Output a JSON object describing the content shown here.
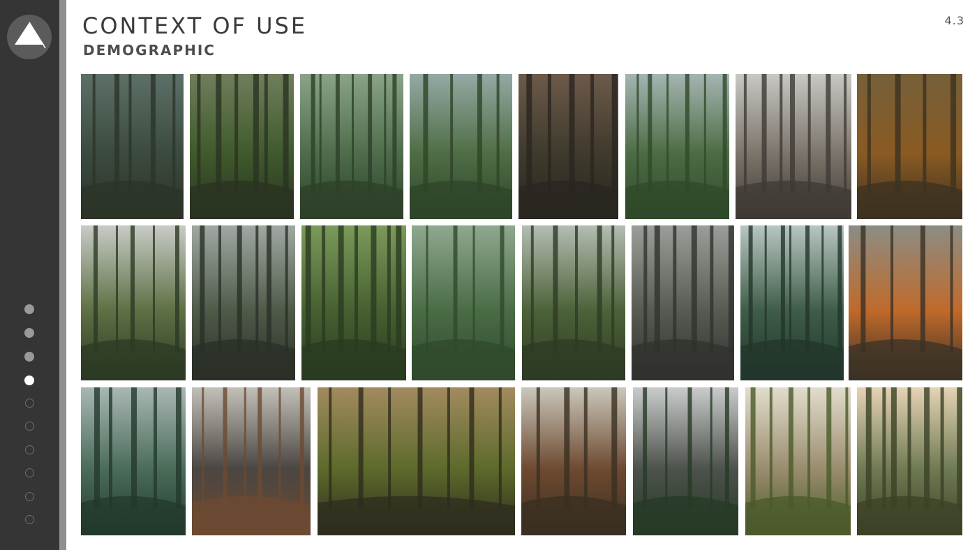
{
  "slide": {
    "title": "CONTEXT OF USE",
    "subtitle": "DEMOGRAPHIC",
    "page_number": "4.3"
  },
  "logo": {
    "icon": "mountain-triangle-icon"
  },
  "progress": {
    "total_steps": 10,
    "current_step": 4
  },
  "colors": {
    "sidebar": "#353535",
    "sidebar_edge": "#8f8f8f",
    "title_text": "#3a3a3a"
  },
  "gallery": {
    "rows": [
      {
        "photos": [
          {
            "scene": "misty-forest-path",
            "palette": [
              "#5d7067",
              "#3b4a3f",
              "#2c3428"
            ]
          },
          {
            "scene": "mossy-trail",
            "palette": [
              "#6f7e5c",
              "#3f5a2c",
              "#2a3322"
            ]
          },
          {
            "scene": "green-forest-path",
            "palette": [
              "#8aa389",
              "#4e6c4b",
              "#2d4029"
            ]
          },
          {
            "scene": "hikers-mountain-lake",
            "palette": [
              "#94a9a4",
              "#4e6d45",
              "#2f4428"
            ]
          },
          {
            "scene": "dark-pine-forest",
            "palette": [
              "#6d5a4a",
              "#3e3a2c",
              "#2a2620"
            ]
          },
          {
            "scene": "alpine-stream",
            "palette": [
              "#a5b5b3",
              "#4c6c44",
              "#2f4a2a"
            ]
          },
          {
            "scene": "foggy-forest-walker",
            "palette": [
              "#c8c8c4",
              "#7b746a",
              "#3f3a34"
            ]
          },
          {
            "scene": "autumn-forest",
            "palette": [
              "#75603a",
              "#8a5a22",
              "#3c3221"
            ]
          }
        ]
      },
      {
        "photos": [
          {
            "scene": "hiker-fog-ridge",
            "palette": [
              "#c7cbc6",
              "#5e7044",
              "#2c3a24"
            ]
          },
          {
            "scene": "lake-trail",
            "palette": [
              "#9fa9a2",
              "#4f5a48",
              "#2a2f28"
            ]
          },
          {
            "scene": "dense-green-woods",
            "palette": [
              "#7c9a5b",
              "#466031",
              "#2a3b20"
            ]
          },
          {
            "scene": "foggy-green-hiker",
            "palette": [
              "#8fa890",
              "#4a6c45",
              "#2f4a2c"
            ]
          },
          {
            "scene": "forest-creek-rocks",
            "palette": [
              "#b4bdb3",
              "#4c6238",
              "#2e3b25"
            ]
          },
          {
            "scene": "misty-hiker-trees",
            "palette": [
              "#9b9e98",
              "#575b53",
              "#30322e"
            ]
          },
          {
            "scene": "waterfall-pines",
            "palette": [
              "#b9c6c2",
              "#3e5d48",
              "#23362b"
            ]
          },
          {
            "scene": "orange-ferns-forest",
            "palette": [
              "#8b8d85",
              "#c06a2a",
              "#3a3126"
            ]
          }
        ]
      },
      {
        "photos": [
          {
            "scene": "fog-over-pines",
            "palette": [
              "#a9b7b3",
              "#4b6c5a",
              "#223a2c"
            ]
          },
          {
            "scene": "bare-trunk-forest",
            "palette": [
              "#c3c0ba",
              "#4b4641",
              "#6d4a32"
            ]
          },
          {
            "scene": "sunlit-forest-path",
            "palette": [
              "#a28b5f",
              "#5d6a2b",
              "#2f2c1e"
            ]
          },
          {
            "scene": "redwood-road",
            "palette": [
              "#c9c7bc",
              "#6e4a30",
              "#3a2f22"
            ]
          },
          {
            "scene": "cloudy-mountain",
            "palette": [
              "#c9cccb",
              "#4d524c",
              "#263a25"
            ]
          },
          {
            "scene": "valley-sunrise",
            "palette": [
              "#e2ddcc",
              "#9a8d6e",
              "#4a5a2a"
            ]
          },
          {
            "scene": "mountain-trail-sunset",
            "palette": [
              "#e6d3b5",
              "#6f7b54",
              "#3b4126"
            ]
          }
        ]
      }
    ]
  }
}
